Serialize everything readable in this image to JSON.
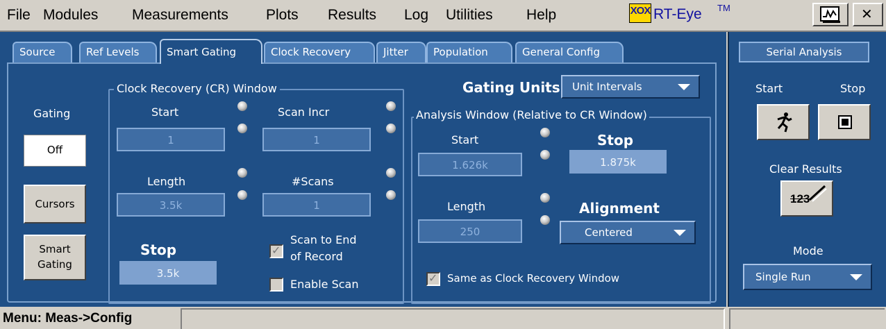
{
  "menu": {
    "items": [
      "File",
      "Modules",
      "Measurements",
      "Plots",
      "Results",
      "Log",
      "Utilities",
      "Help"
    ]
  },
  "brand": {
    "logo_text": "XOX",
    "name": "RT-Eye",
    "trademark": "TM"
  },
  "window_buttons": {
    "close": "✕",
    "display_icon": "waveform-icon"
  },
  "tabs": [
    "Source",
    "Ref Levels",
    "Smart Gating",
    "Clock Recovery",
    "Jitter",
    "Population",
    "General Config"
  ],
  "active_tab": "Smart Gating",
  "gating": {
    "label": "Gating",
    "off_label": "Off",
    "cursors_label": "Cursors",
    "smart_gating_label": [
      "Smart",
      "Gating"
    ]
  },
  "cr_window": {
    "title": "Clock Recovery (CR) Window",
    "start_label": "Start",
    "start_value": "1",
    "scan_incr_label": "Scan Incr",
    "scan_incr_value": "1",
    "length_label": "Length",
    "length_value": "3.5k",
    "scans_label": "#Scans",
    "scans_value": "1",
    "stop_label": "Stop",
    "stop_value": "3.5k",
    "scan_to_end_label": [
      "Scan to End",
      "of Record"
    ],
    "scan_to_end_checked": true,
    "enable_scan_label": "Enable Scan",
    "enable_scan_checked": false
  },
  "gating_units": {
    "label": "Gating Units",
    "value": "Unit Intervals"
  },
  "analysis_window": {
    "title": "Analysis Window (Relative to CR Window)",
    "start_label": "Start",
    "start_value": "1.626k",
    "stop_label": "Stop",
    "stop_value": "1.875k",
    "length_label": "Length",
    "length_value": "250",
    "alignment_label": "Alignment",
    "alignment_value": "Centered",
    "same_as_cr_label": "Same as Clock Recovery Window",
    "same_as_cr_checked": true
  },
  "serial_analysis": {
    "title": "Serial Analysis",
    "start_label": "Start",
    "stop_label": "Stop",
    "clear_results_label": "Clear Results",
    "clear_icon_text": "123",
    "mode_label": "Mode",
    "mode_value": "Single Run"
  },
  "status": {
    "menu_path": "Menu: Meas->Config"
  }
}
